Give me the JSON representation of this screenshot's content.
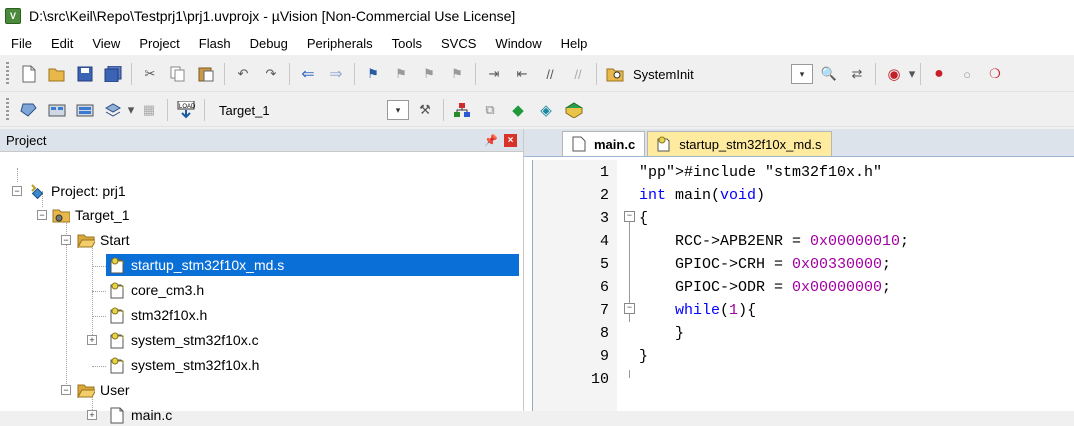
{
  "window": {
    "title": "D:\\src\\Keil\\Repo\\Testprj1\\prj1.uvprojx - µVision  [Non-Commercial Use License]",
    "app_icon_text": "V"
  },
  "menu": [
    "File",
    "Edit",
    "View",
    "Project",
    "Flash",
    "Debug",
    "Peripherals",
    "Tools",
    "SVCS",
    "Window",
    "Help"
  ],
  "toolbar1": {
    "function_name": "SystemInit"
  },
  "toolbar2": {
    "target_name": "Target_1"
  },
  "project_pane": {
    "title": "Project",
    "tree": {
      "project": "Project: prj1",
      "target": "Target_1",
      "group_start": "Start",
      "files_start": [
        "startup_stm32f10x_md.s",
        "core_cm3.h",
        "stm32f10x.h",
        "system_stm32f10x.c",
        "system_stm32f10x.h"
      ],
      "group_user": "User",
      "files_user": [
        "main.c"
      ]
    }
  },
  "editor": {
    "tabs": [
      "main.c",
      "startup_stm32f10x_md.s"
    ],
    "active_tab": "main.c",
    "line_numbers": [
      "1",
      "2",
      "3",
      "4",
      "5",
      "6",
      "7",
      "8",
      "9",
      "10"
    ],
    "code": [
      "#include \"stm32f10x.h\"",
      "int main(void)",
      "{",
      "    RCC->APB2ENR = 0x00000010;",
      "    GPIOC->CRH = 0x00330000;",
      "    GPIOC->ODR = 0x00000000;",
      "    while(1){",
      "    }",
      "}",
      ""
    ]
  },
  "colors": {
    "selection": "#0a6fd6",
    "keyword": "#0000ff",
    "preprocessor": "#808080",
    "string": "#a31515",
    "number": "#a000a0",
    "pane_header": "#dde3ea",
    "inactive_tab": "#ffeba0"
  }
}
